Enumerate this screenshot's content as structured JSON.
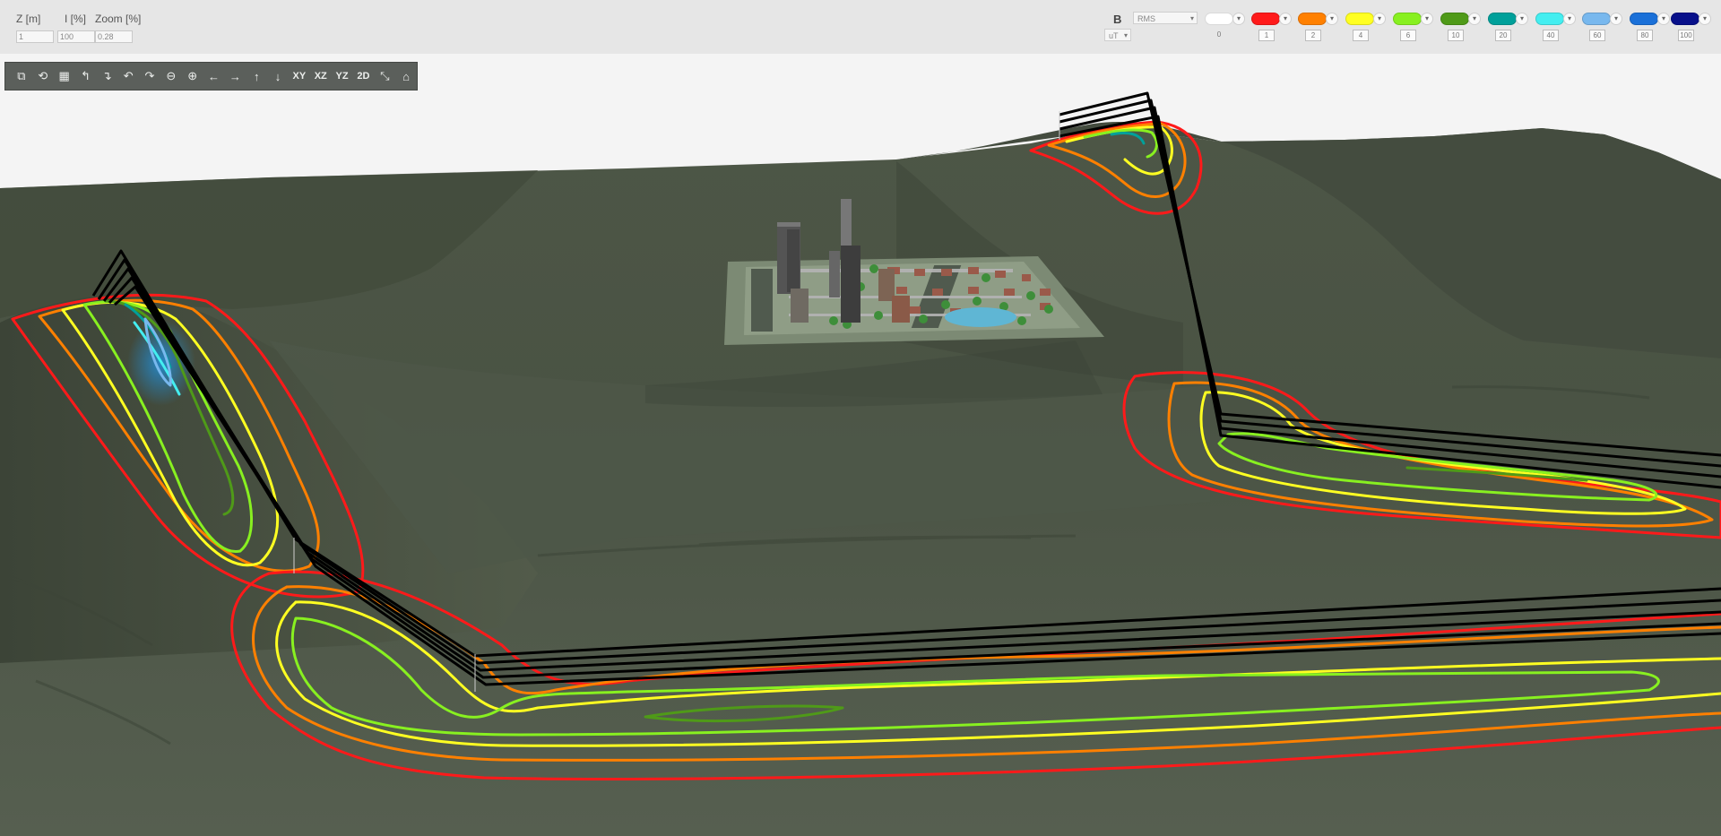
{
  "params": {
    "z_label": "Z [m]",
    "z_value": "1",
    "i_label": "I [%]",
    "i_value": "100",
    "zoom_label": "Zoom [%]",
    "zoom_value": "0.28"
  },
  "field": {
    "label": "B",
    "mode": "RMS",
    "unit": "uT"
  },
  "legend": [
    {
      "color": "#ffffff",
      "threshold": "0"
    },
    {
      "color": "#ff1a1a",
      "threshold": "1"
    },
    {
      "color": "#ff8000",
      "threshold": "2"
    },
    {
      "color": "#ffff22",
      "threshold": "4"
    },
    {
      "color": "#88f020",
      "threshold": "6"
    },
    {
      "color": "#4f9a18",
      "threshold": "10"
    },
    {
      "color": "#00a09a",
      "threshold": "20"
    },
    {
      "color": "#44eef0",
      "threshold": "40"
    },
    {
      "color": "#78b8ee",
      "threshold": "60"
    },
    {
      "color": "#1a70d8",
      "threshold": "80"
    },
    {
      "color": "#08108a",
      "threshold": "100"
    }
  ],
  "toolbar": [
    {
      "name": "copy-icon",
      "glyph": "⧉"
    },
    {
      "name": "clear-view-icon",
      "glyph": "⟲"
    },
    {
      "name": "grid-icon",
      "glyph": "▦"
    },
    {
      "name": "rotate-left-up-icon",
      "glyph": "↰"
    },
    {
      "name": "rotate-right-down-icon",
      "glyph": "↴"
    },
    {
      "name": "undo-icon",
      "glyph": "↶"
    },
    {
      "name": "redo-icon",
      "glyph": "↷"
    },
    {
      "name": "zoom-out-icon",
      "glyph": "⊖"
    },
    {
      "name": "zoom-in-icon",
      "glyph": "⊕"
    },
    {
      "name": "arrow-left-icon",
      "glyph": "←"
    },
    {
      "name": "arrow-right-icon",
      "glyph": "→"
    },
    {
      "name": "arrow-up-icon",
      "glyph": "↑"
    },
    {
      "name": "arrow-down-icon",
      "glyph": "↓"
    },
    {
      "name": "view-xy-button",
      "glyph": "XY"
    },
    {
      "name": "view-xz-button",
      "glyph": "XZ"
    },
    {
      "name": "view-yz-button",
      "glyph": "YZ"
    },
    {
      "name": "view-2d-button",
      "glyph": "2D"
    },
    {
      "name": "axes-icon",
      "glyph": "⤡"
    },
    {
      "name": "home-view-icon",
      "glyph": "⌂"
    }
  ]
}
